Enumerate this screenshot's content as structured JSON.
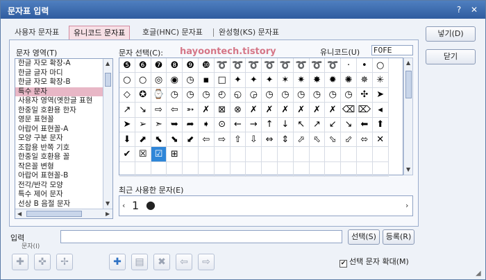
{
  "window": {
    "title": "문자표 입력",
    "help_glyph": "?",
    "close_glyph": "✕"
  },
  "tabs": [
    {
      "label": "사용자 문자표"
    },
    {
      "label": "유니코드 문자표"
    },
    {
      "label": "호글(HNC) 문자표"
    },
    {
      "label": "완성형(KS) 문자표"
    }
  ],
  "labels": {
    "area": "문자 영역(T)",
    "select": "문자 선택(C):",
    "unicode": "유니코드(U)",
    "recent": "최근 사용한 문자(E)",
    "input": "입력",
    "input_sub": "문자(I)"
  },
  "unicode_value": "F0FE",
  "watermark": "hayoontech.tistory",
  "area_list": [
    "한글 자모 확장-A",
    "한글 글자 마디",
    "한글 자모 확장-B",
    "특수 문자",
    "사용자 영역(옛한글 표현",
    "한중일 호환용 한자",
    "영문 표현꼴",
    "아랍어 표현꼴-A",
    "모양 구분 문자",
    "조합용 반쪽 기호",
    "한중일 호환용 꼴",
    "작은꼴 변형",
    "아랍어 표현꼴-B",
    "전각/반각 모양",
    "특수 제어 문자",
    "선상 B 음절 문자"
  ],
  "selected_area_index": 3,
  "grid": [
    [
      "❺",
      "❻",
      "❼",
      "❽",
      "❾",
      "❿",
      "➰",
      "➰",
      "➰",
      "➰",
      "➰",
      "➰",
      "➰",
      "➰",
      "·",
      "•",
      "○"
    ],
    [
      "○",
      "○",
      "◎",
      "◉",
      "◷",
      "▪",
      "□",
      "✦",
      "✦",
      "✦",
      "✶",
      "✷",
      "✸",
      "✹",
      "✺",
      "✵",
      "✳"
    ],
    [
      "◇",
      "✪",
      "⌚",
      "◷",
      "◷",
      "◷",
      "◴",
      "◵",
      "◶",
      "◷",
      "◷",
      "◷",
      "◷",
      "◷",
      "◷",
      "✣",
      "➤"
    ],
    [
      "↗",
      "↘",
      "⇨",
      "⇦",
      "➳",
      "✗",
      "⊠",
      "⊗",
      "✗",
      "✗",
      "✗",
      "✗",
      "✗",
      "✗",
      "⌫",
      "⌦",
      "◂"
    ],
    [
      "➤",
      "➢",
      "➣",
      "➥",
      "➦",
      "➧",
      "⊙",
      "←",
      "→",
      "↑",
      "↓",
      "↖",
      "↗",
      "↙",
      "↘",
      "⬅",
      "⬆"
    ],
    [
      "⬇",
      "⬈",
      "⬉",
      "⬊",
      "⬋",
      "⇦",
      "⇨",
      "⇧",
      "⇩",
      "⇔",
      "⇕",
      "⬀",
      "⬁",
      "⬂",
      "⬃",
      "⬄",
      "✕"
    ],
    [
      "✔",
      "☒",
      "☑",
      "⊞",
      "",
      "",
      "",
      "",
      "",
      "",
      "",
      "",
      "",
      "",
      "",
      "",
      ""
    ],
    [
      "",
      "",
      "",
      "",
      "",
      "",
      "",
      "",
      "",
      "",
      "",
      "",
      "",
      "",
      "",
      "",
      ""
    ]
  ],
  "selected_cell": {
    "row": 6,
    "col": 2
  },
  "recent_chars": [
    "1",
    "●"
  ],
  "buttons": {
    "insert": "넣기(D)",
    "close": "닫기",
    "select": "선택(S)",
    "register": "등록(R)",
    "enlarge": "선택 문자 확대(M)"
  },
  "toolbar_icons": [
    "add-icon",
    "remove-icon",
    "move-icon",
    "plus-icon",
    "edit-icon",
    "delete-icon",
    "left-arrow-icon",
    "right-arrow-icon"
  ]
}
